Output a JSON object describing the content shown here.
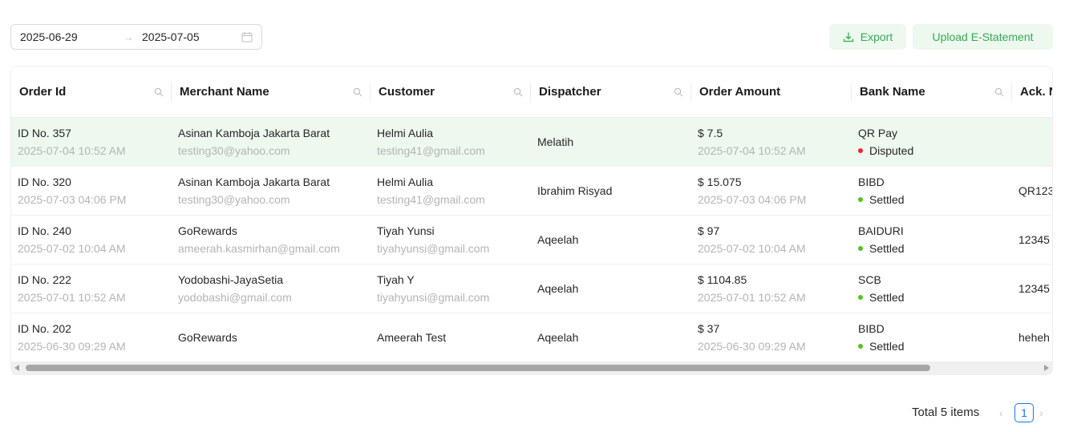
{
  "filters": {
    "start_date": "2025-06-29",
    "end_date": "2025-07-05",
    "separator": "→"
  },
  "toolbar": {
    "export_label": "Export",
    "upload_label": "Upload E-Statement"
  },
  "table": {
    "columns": [
      "Order Id",
      "Merchant Name",
      "Customer",
      "Dispatcher",
      "Order Amount",
      "Bank Name",
      "Ack. N"
    ],
    "rows": [
      {
        "order_id": "ID No. 357",
        "order_time": "2025-07-04 10:52 AM",
        "merchant": "Asinan Kamboja Jakarta Barat",
        "merchant_email": "testing30@yahoo.com",
        "customer": "Helmi Aulia",
        "customer_email": "testing41@gmail.com",
        "dispatcher": "Melatih",
        "amount": "$ 7.5",
        "amount_time": "2025-07-04 10:52 AM",
        "bank": "QR Pay",
        "status": "Disputed",
        "status_color": "#f5222d",
        "ack": ""
      },
      {
        "order_id": "ID No. 320",
        "order_time": "2025-07-03 04:06 PM",
        "merchant": "Asinan Kamboja Jakarta Barat",
        "merchant_email": "testing30@yahoo.com",
        "customer": "Helmi Aulia",
        "customer_email": "testing41@gmail.com",
        "dispatcher": "Ibrahim Risyad",
        "amount": "$ 15.075",
        "amount_time": "2025-07-03 04:06 PM",
        "bank": "BIBD",
        "status": "Settled",
        "status_color": "#52c41a",
        "ack": "QR123"
      },
      {
        "order_id": "ID No. 240",
        "order_time": "2025-07-02 10:04 AM",
        "merchant": "GoRewards",
        "merchant_email": "ameerah.kasmirhan@gmail.com",
        "customer": "Tiyah Yunsi",
        "customer_email": "tiyahyunsi@gmail.com",
        "dispatcher": "Aqeelah",
        "amount": "$ 97",
        "amount_time": "2025-07-02 10:04 AM",
        "bank": "BAIDURI",
        "status": "Settled",
        "status_color": "#52c41a",
        "ack": "12345"
      },
      {
        "order_id": "ID No. 222",
        "order_time": "2025-07-01 10:52 AM",
        "merchant": "Yodobashi-JayaSetia",
        "merchant_email": "yodobashi@gmail.com",
        "customer": "Tiyah Y",
        "customer_email": "tiyahyunsi@gmail.com",
        "dispatcher": "Aqeelah",
        "amount": "$ 1104.85",
        "amount_time": "2025-07-01 10:52 AM",
        "bank": "SCB",
        "status": "Settled",
        "status_color": "#52c41a",
        "ack": "12345"
      },
      {
        "order_id": "ID No. 202",
        "order_time": "2025-06-30 09:29 AM",
        "merchant": "GoRewards",
        "merchant_email": "",
        "customer": "Ameerah Test",
        "customer_email": "",
        "dispatcher": "Aqeelah",
        "amount": "$ 37",
        "amount_time": "2025-06-30 09:29 AM",
        "bank": "BIBD",
        "status": "Settled",
        "status_color": "#52c41a",
        "ack": "heheh"
      }
    ]
  },
  "pagination": {
    "total_label": "Total 5 items",
    "current_page": "1",
    "prev": "‹",
    "next": "›"
  },
  "colors": {
    "accent": "#3aaa55",
    "selected_row": "#edf8ef",
    "page_active": "#1677ff"
  }
}
